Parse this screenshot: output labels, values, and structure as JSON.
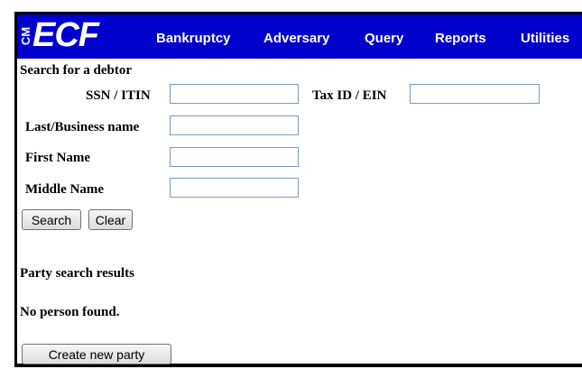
{
  "app": {
    "logo_text": "ECF",
    "logo_prefix": "CM"
  },
  "nav": {
    "items": [
      "Bankruptcy",
      "Adversary",
      "Query",
      "Reports",
      "Utilities"
    ]
  },
  "search": {
    "title": "Search for a debtor",
    "ssn_label": "SSN / ITIN",
    "ssn_value": "",
    "taxid_label": "Tax ID / EIN",
    "taxid_value": "",
    "lastname_label": "Last/Business name",
    "lastname_value": "",
    "firstname_label": "First Name",
    "firstname_value": "",
    "middlename_label": "Middle Name",
    "middlename_value": "",
    "search_button": "Search",
    "clear_button": "Clear"
  },
  "results": {
    "title": "Party search results",
    "message": "No person found.",
    "create_button": "Create new party"
  },
  "colors": {
    "navbar": "#0000cc",
    "input_border": "#7a9cc0"
  }
}
